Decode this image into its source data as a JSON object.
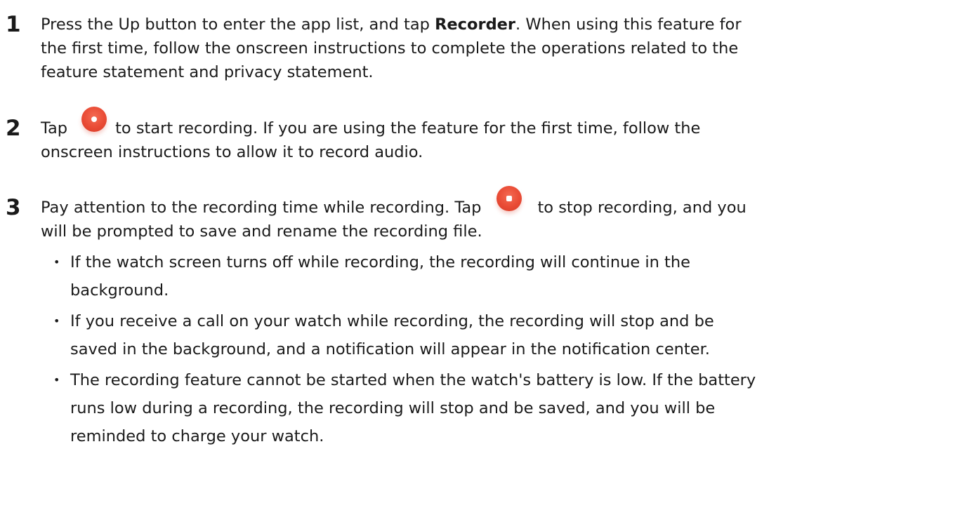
{
  "steps": [
    {
      "number": "1",
      "lines": [
        {
          "before": "Press the Up button to enter the app list, and tap ",
          "bold": "Recorder",
          "after": ". When using this feature for"
        },
        {
          "text": "the first time, follow the onscreen instructions to complete the operations related to the"
        },
        {
          "text": "feature statement and privacy statement."
        }
      ]
    },
    {
      "number": "2",
      "lines": [
        {
          "before": "Tap",
          "icon": "record-icon",
          "after": "to start recording. If you are using the feature for the first time, follow the"
        },
        {
          "text": "onscreen instructions to allow it to record audio."
        }
      ]
    },
    {
      "number": "3",
      "lines": [
        {
          "before": "Pay attention to the recording time while recording. Tap",
          "icon": "stop-recording-icon",
          "after": "to stop recording, and you"
        },
        {
          "text": "will be prompted to save and rename the recording file."
        }
      ]
    }
  ],
  "bullets": [
    {
      "lines": [
        "If the watch screen turns off while recording, the recording will continue in the",
        "background."
      ]
    },
    {
      "lines": [
        "If you receive a call on your watch while recording, the recording will stop and be",
        "saved in the background, and a notification will appear in the notification center."
      ]
    },
    {
      "lines": [
        "The recording feature cannot be started when the watch's battery is low. If the battery",
        "runs low during a recording, the recording will stop and be saved, and you will be",
        "reminded to charge your watch."
      ]
    }
  ],
  "bullet_symbol": "•",
  "icon_color": "#e94b35"
}
